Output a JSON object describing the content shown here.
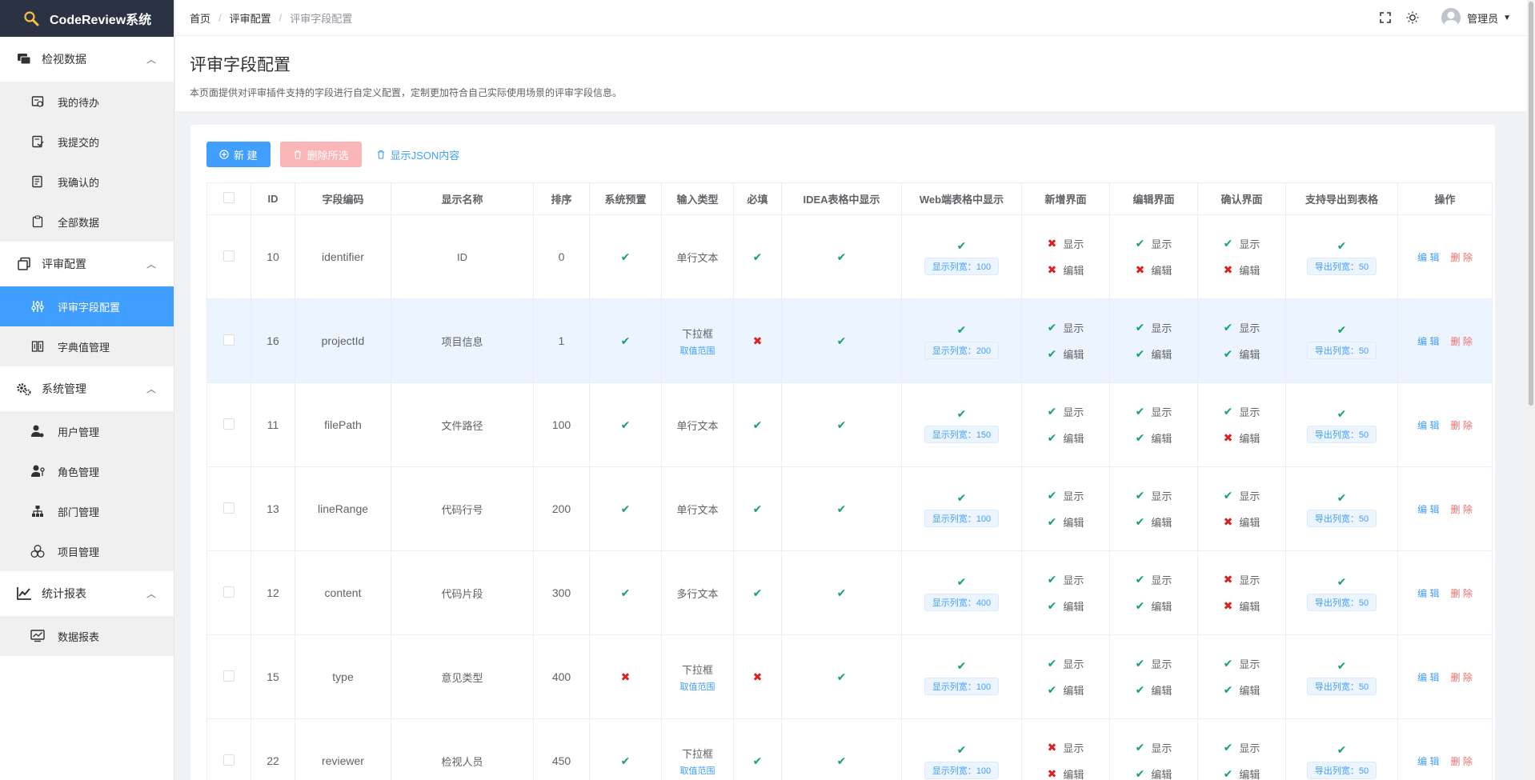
{
  "app": {
    "title": "CodeReview系统"
  },
  "sidebar": {
    "groups": [
      {
        "title": "检视数据",
        "expanded": true,
        "items": [
          "我的待办",
          "我提交的",
          "我确认的",
          "全部数据"
        ]
      },
      {
        "title": "评审配置",
        "expanded": true,
        "items": [
          "评审字段配置",
          "字典值管理"
        ]
      },
      {
        "title": "系统管理",
        "expanded": true,
        "items": [
          "用户管理",
          "角色管理",
          "部门管理",
          "项目管理"
        ]
      },
      {
        "title": "统计报表",
        "expanded": true,
        "items": [
          "数据报表"
        ]
      }
    ],
    "active_item": "评审字段配置"
  },
  "header": {
    "breadcrumb": [
      "首页",
      "评审配置",
      "评审字段配置"
    ],
    "user_name": "管理员"
  },
  "page": {
    "title": "评审字段配置",
    "description": "本页面提供对评审插件支持的字段进行自定义配置，定制更加符合自己实际使用场景的评审字段信息。"
  },
  "toolbar": {
    "new_label": "新 建",
    "delete_label": "删除所选",
    "json_label": "显示JSON内容"
  },
  "table": {
    "columns": [
      "",
      "ID",
      "字段编码",
      "显示名称",
      "排序",
      "系统预置",
      "输入类型",
      "必填",
      "IDEA表格中显示",
      "Web端表格中显示",
      "新增界面",
      "编辑界面",
      "确认界面",
      "支持导出到表格",
      "操作"
    ],
    "labels": {
      "show": "显示",
      "edit": "编辑",
      "range": "取值范围",
      "width_prefix": "显示列宽：",
      "export_prefix": "导出列宽：",
      "op_edit": "编 辑",
      "op_delete": "删 除"
    },
    "rows": [
      {
        "id": "10",
        "code": "identifier",
        "name": "ID",
        "sort": "0",
        "preset": true,
        "input": "单行文本",
        "has_range": false,
        "required": true,
        "idea": true,
        "web_width": "100",
        "add_show": false,
        "add_edit": false,
        "edit_show": true,
        "edit_edit": false,
        "confirm_show": true,
        "confirm_edit": false,
        "export_width": "50"
      },
      {
        "id": "16",
        "code": "projectId",
        "name": "项目信息",
        "sort": "1",
        "preset": true,
        "input": "下拉框",
        "has_range": true,
        "required": false,
        "idea": true,
        "web_width": "200",
        "add_show": true,
        "add_edit": true,
        "edit_show": true,
        "edit_edit": true,
        "confirm_show": true,
        "confirm_edit": true,
        "export_width": "50"
      },
      {
        "id": "11",
        "code": "filePath",
        "name": "文件路径",
        "sort": "100",
        "preset": true,
        "input": "单行文本",
        "has_range": false,
        "required": true,
        "idea": true,
        "web_width": "150",
        "add_show": true,
        "add_edit": true,
        "edit_show": true,
        "edit_edit": true,
        "confirm_show": true,
        "confirm_edit": false,
        "export_width": "50"
      },
      {
        "id": "13",
        "code": "lineRange",
        "name": "代码行号",
        "sort": "200",
        "preset": true,
        "input": "单行文本",
        "has_range": false,
        "required": true,
        "idea": true,
        "web_width": "100",
        "add_show": true,
        "add_edit": true,
        "edit_show": true,
        "edit_edit": true,
        "confirm_show": true,
        "confirm_edit": false,
        "export_width": "50"
      },
      {
        "id": "12",
        "code": "content",
        "name": "代码片段",
        "sort": "300",
        "preset": true,
        "input": "多行文本",
        "has_range": false,
        "required": true,
        "idea": true,
        "web_width": "400",
        "add_show": true,
        "add_edit": true,
        "edit_show": true,
        "edit_edit": true,
        "confirm_show": false,
        "confirm_edit": false,
        "export_width": "50"
      },
      {
        "id": "15",
        "code": "type",
        "name": "意见类型",
        "sort": "400",
        "preset": false,
        "input": "下拉框",
        "has_range": true,
        "required": false,
        "idea": true,
        "web_width": "100",
        "add_show": true,
        "add_edit": true,
        "edit_show": true,
        "edit_edit": true,
        "confirm_show": true,
        "confirm_edit": true,
        "export_width": "50"
      },
      {
        "id": "22",
        "code": "reviewer",
        "name": "检视人员",
        "sort": "450",
        "preset": true,
        "input": "下拉框",
        "has_range": true,
        "required": true,
        "idea": true,
        "web_width": "100",
        "add_show": false,
        "add_edit": false,
        "edit_show": true,
        "edit_edit": true,
        "confirm_show": true,
        "confirm_edit": true,
        "export_width": "50"
      }
    ],
    "highlight_row": 1
  },
  "colors": {
    "primary": "#409eff",
    "danger": "#f56c6c",
    "success": "#13a36b",
    "error": "#e02020",
    "sidebar_header": "#2b3243"
  }
}
